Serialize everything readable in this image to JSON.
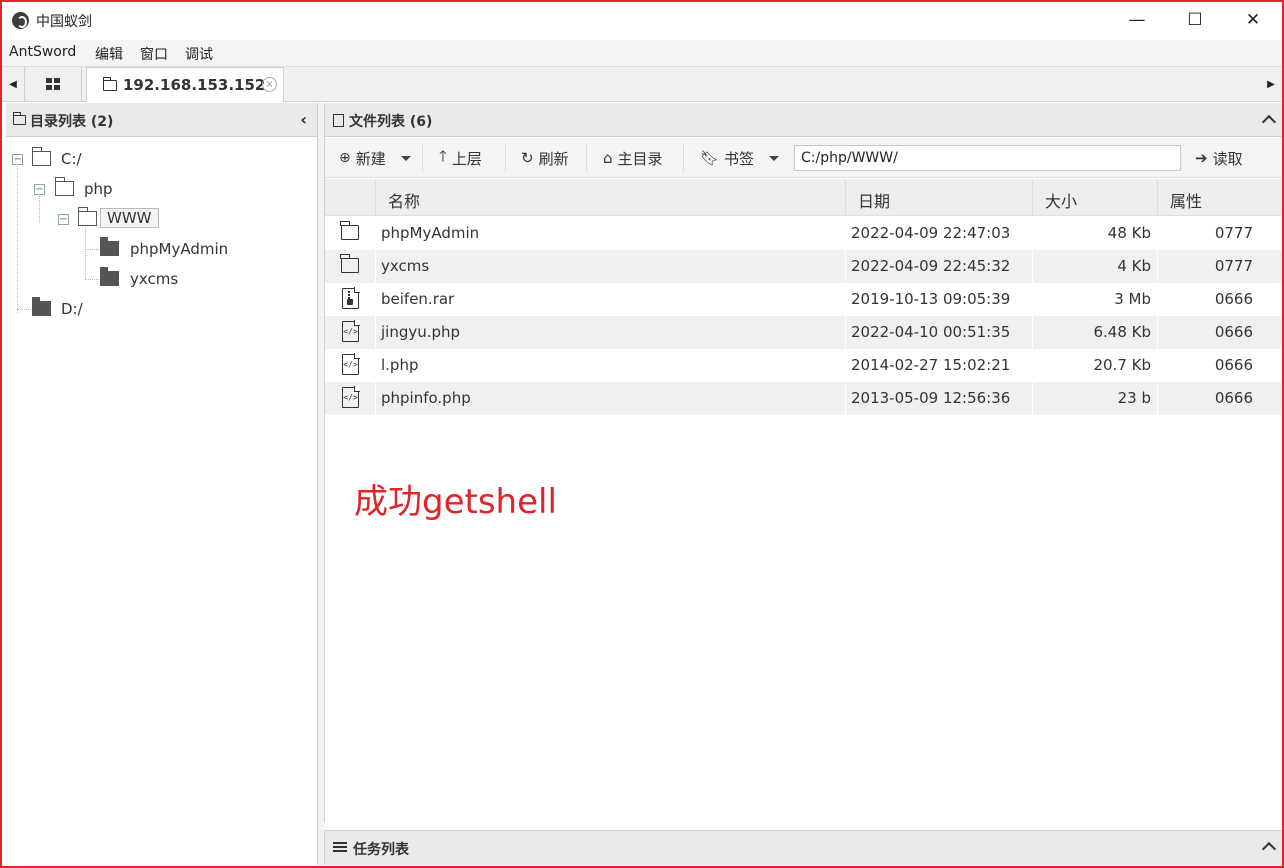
{
  "window": {
    "title": "中国蚁剑",
    "minimize": "—",
    "maximize": "☐",
    "close": "✕"
  },
  "menu": [
    "AntSword",
    "编辑",
    "窗口",
    "调试"
  ],
  "tabs": {
    "active_label": "192.168.153.152",
    "close_glyph": "×"
  },
  "dir_panel": {
    "title": "目录列表 (2)",
    "tree": [
      {
        "label": "C:/"
      },
      {
        "label": "php"
      },
      {
        "label": "WWW"
      },
      {
        "label": "phpMyAdmin"
      },
      {
        "label": "yxcms"
      },
      {
        "label": "D:/"
      }
    ]
  },
  "file_panel": {
    "title": "文件列表 (6)",
    "toolbar": {
      "new_label": "新建",
      "up_label": "上层",
      "refresh_label": "刷新",
      "home_label": "主目录",
      "bookmark_label": "书签",
      "path_value": "C:/php/WWW/",
      "read_label": "读取"
    },
    "columns": [
      "名称",
      "日期",
      "大小",
      "属性"
    ],
    "rows": [
      {
        "icon": "folder-icon",
        "name": "phpMyAdmin",
        "date": "2022-04-09 22:47:03",
        "size": "48 Kb",
        "attr": "0777"
      },
      {
        "icon": "folder-icon",
        "name": "yxcms",
        "date": "2022-04-09 22:45:32",
        "size": "4 Kb",
        "attr": "0777"
      },
      {
        "icon": "archive-file-icon",
        "name": "beifen.rar",
        "date": "2019-10-13 09:05:39",
        "size": "3 Mb",
        "attr": "0666"
      },
      {
        "icon": "code-file-icon",
        "name": "jingyu.php",
        "date": "2022-04-10 00:51:35",
        "size": "6.48 Kb",
        "attr": "0666"
      },
      {
        "icon": "code-file-icon",
        "name": "l.php",
        "date": "2014-02-27 15:02:21",
        "size": "20.7 Kb",
        "attr": "0666"
      },
      {
        "icon": "code-file-icon",
        "name": "phpinfo.php",
        "date": "2013-05-09 12:56:36",
        "size": "23 b",
        "attr": "0666"
      }
    ]
  },
  "annotation": "成功getshell",
  "task_panel": {
    "title": "任务列表"
  },
  "colors": {
    "frame": "#e0242c",
    "annotation": "#e0242c"
  }
}
